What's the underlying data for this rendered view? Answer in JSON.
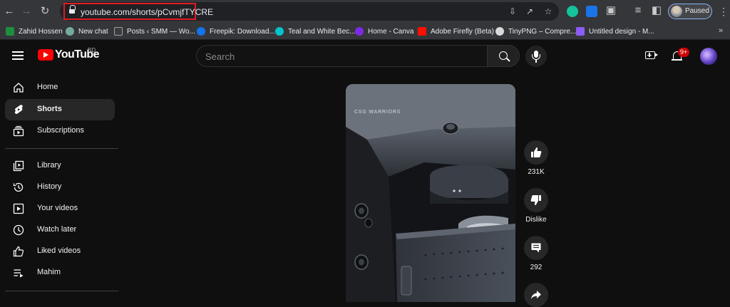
{
  "browser": {
    "url": "youtube.com/shorts/pCvmjfTYCRE",
    "profile_status": "Paused",
    "bookmarks": [
      {
        "label": "Zahid Hossen",
        "color": "#1e8e3e"
      },
      {
        "label": "New chat",
        "color": "#74aa9c"
      },
      {
        "label": "Posts ‹ SMM — Wo...",
        "color": "#f2f2f2"
      },
      {
        "label": "Freepik: Download...",
        "color": "#1273eb"
      },
      {
        "label": "Teal and White Bec...",
        "color": "#00c4cc"
      },
      {
        "label": "Home - Canva",
        "color": "#7d2ae8"
      },
      {
        "label": "Adobe Firefly (Beta)",
        "color": "#fa0f00"
      },
      {
        "label": "TinyPNG – Compre...",
        "color": "#d9d9d9"
      },
      {
        "label": "Untitled design - M...",
        "color": "#8b5cf6"
      }
    ]
  },
  "header": {
    "logo_text": "YouTube",
    "country_code": "BD",
    "search_placeholder": "Search",
    "notification_count": "9+"
  },
  "sidebar": {
    "items": [
      {
        "label": "Home",
        "icon": "home-icon"
      },
      {
        "label": "Shorts",
        "icon": "shorts-icon",
        "active": true
      },
      {
        "label": "Subscriptions",
        "icon": "subscriptions-icon"
      },
      {
        "label": "Library",
        "icon": "library-icon"
      },
      {
        "label": "History",
        "icon": "history-icon"
      },
      {
        "label": "Your videos",
        "icon": "your-videos-icon"
      },
      {
        "label": "Watch later",
        "icon": "watch-later-icon"
      },
      {
        "label": "Liked videos",
        "icon": "liked-videos-icon"
      },
      {
        "label": "Mahim",
        "icon": "playlist-icon"
      }
    ]
  },
  "short": {
    "watermark": "CSG WARRIORS",
    "likes": "231K",
    "dislike_label": "Dislike",
    "comments": "292"
  }
}
